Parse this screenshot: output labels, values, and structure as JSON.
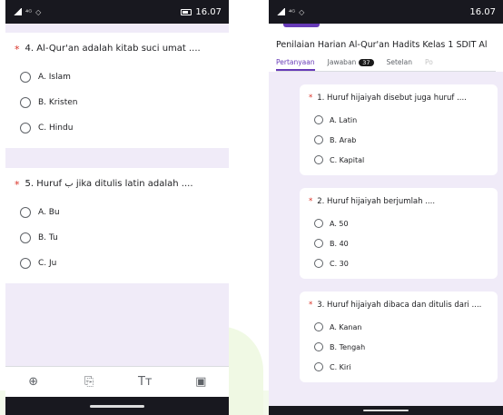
{
  "left_phone": {
    "status": {
      "time": "16.07",
      "signal_text": "⁴ᴳ"
    },
    "q4": {
      "label": "4. Al-Qur'an adalah kitab suci umat ....",
      "required_mark": "*",
      "options": [
        "A. Islam",
        "B. Kristen",
        "C. Hindu"
      ]
    },
    "q5": {
      "label": "5. Huruf ب jika ditulis latin adalah ....",
      "required_mark": "*",
      "options": [
        "A. Bu",
        "B. Tu",
        "C. Ju"
      ]
    },
    "toolbar": {
      "icons": [
        "add-circle-icon",
        "import-question-icon",
        "text-format-icon",
        "image-icon"
      ],
      "glyphs": [
        "⊕",
        "⎘",
        "Tт",
        "▣"
      ]
    }
  },
  "right_phone": {
    "status": {
      "time": "16.07",
      "signal_text": "⁴ᴳ"
    },
    "form_title": "Penilaian Harian Al-Qur'an Hadits Kelas 1 SDIT Al",
    "tabs": [
      {
        "label": "Pertanyaan",
        "active": true
      },
      {
        "label": "Jawaban",
        "badge": "37"
      },
      {
        "label": "Setelan"
      },
      {
        "label": "Po"
      }
    ],
    "q1": {
      "label": "1. Huruf hijaiyah disebut juga huruf ....",
      "required_mark": "*",
      "options": [
        "A. Latin",
        "B. Arab",
        "C. Kapital"
      ]
    },
    "q2": {
      "label": "2. Huruf hijaiyah berjumlah ....",
      "required_mark": "*",
      "options": [
        "A. 50",
        "B. 40",
        "C. 30"
      ]
    },
    "q3": {
      "label": "3. Huruf hijaiyah dibaca dan ditulis dari ....",
      "required_mark": "*",
      "options": [
        "A. Kanan",
        "B. Tengah",
        "C. Kiri"
      ]
    }
  },
  "colors": {
    "accent": "#673ab7",
    "required": "#d93025",
    "background": "#f0ebf8",
    "status_bar": "#18181f"
  }
}
